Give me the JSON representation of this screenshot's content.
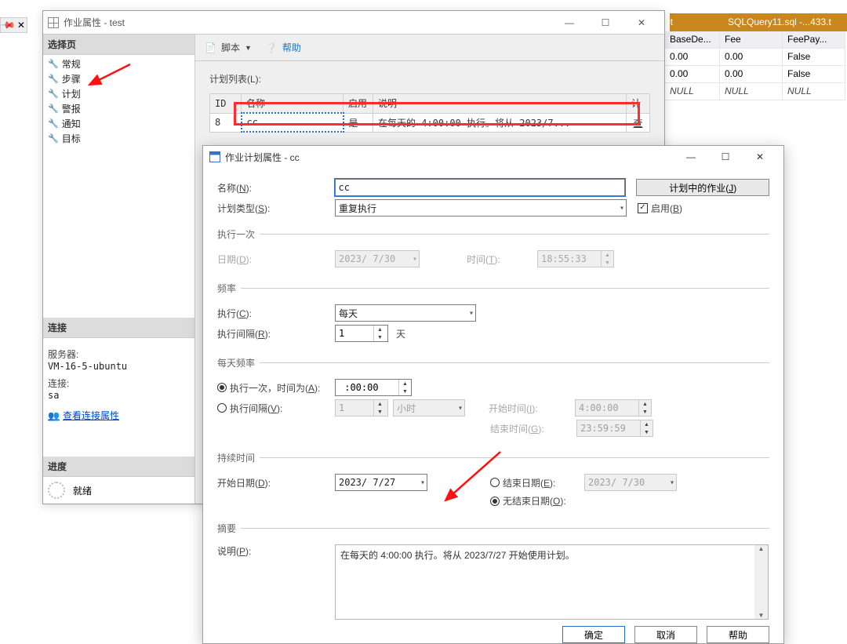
{
  "bg": {
    "tab_title": "SQLQuery11.sql -...433.t",
    "tab_et": "et",
    "headers": [
      "BaseDe...",
      "Fee",
      "FeePay..."
    ],
    "rows": [
      [
        "0.00",
        "0.00",
        "False"
      ],
      [
        "0.00",
        "0.00",
        "False"
      ],
      [
        "NULL",
        "NULL",
        "NULL"
      ]
    ]
  },
  "job": {
    "title": "作业属性 - test",
    "sidebar": {
      "select_page": "选择页",
      "items": [
        "常规",
        "步骤",
        "计划",
        "警报",
        "通知",
        "目标"
      ],
      "connect_hdr": "连接",
      "server_lbl": "服务器:",
      "server_val": "VM-16-5-ubuntu",
      "conn_lbl": "连接:",
      "conn_val": "sa",
      "view_conn": "查看连接属性",
      "progress_hdr": "进度",
      "ready": "就绪"
    },
    "content": {
      "script": "脚本",
      "help": "帮助",
      "plan_list": "计划列表(L):",
      "cols": {
        "id": "ID",
        "name": "名称",
        "enable": "启用",
        "desc": "说明",
        "plan": "计"
      },
      "row": {
        "id": "8",
        "name": "cc",
        "enable": "是",
        "desc": "在每天的 4:00:00 执行。将从 2023/7...",
        "view": "查"
      }
    }
  },
  "sched": {
    "title": "作业计划属性 - cc",
    "name_lbl": "名称(N):",
    "name_val": "cc",
    "jobs_in_plan": "计划中的作业(J)",
    "type_lbl": "计划类型(S):",
    "type_val": "重复执行",
    "enable": "启用(B)",
    "once_grp": "执行一次",
    "date_lbl": "日期(D):",
    "date_val": "2023/ 7/30",
    "time_lbl": "时间(T):",
    "time_val": "18:55:33",
    "freq_grp": "频率",
    "exec_lbl": "执行(C):",
    "exec_val": "每天",
    "interval_lbl": "执行间隔(R):",
    "interval_val": "1",
    "interval_unit": "天",
    "daily_grp": "每天频率",
    "once_at_lbl": "执行一次，时间为(A):",
    "once_at_val": " :00:00",
    "repeat_lbl": "执行间隔(V):",
    "repeat_val": "1",
    "repeat_unit": "小时",
    "start_time_lbl": "开始时间(I):",
    "start_time_val": "4:00:00",
    "end_time_lbl": "结束时间(G):",
    "end_time_val": "23:59:59",
    "duration_grp": "持续时间",
    "start_date_lbl": "开始日期(D):",
    "start_date_val": "2023/ 7/27",
    "end_date_lbl": "结束日期(E):",
    "end_date_val": "2023/ 7/30",
    "no_end_lbl": "无结束日期(O):",
    "summary_grp": "摘要",
    "summary_lbl": "说明(P):",
    "summary_val": "在每天的 4:00:00 执行。将从 2023/7/27 开始使用计划。",
    "ok": "确定",
    "cancel": "取消",
    "help": "帮助"
  }
}
